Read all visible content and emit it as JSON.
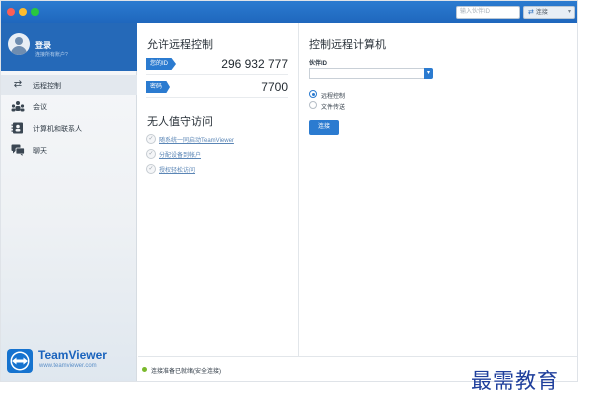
{
  "titlebar": {
    "search_placeholder": "输入伙伴ID",
    "connect_label": "连接"
  },
  "sidebar": {
    "login_title": "登录",
    "login_subtitle": "连接所有账户?",
    "items": [
      {
        "label": "远程控制",
        "icon": "arrows-icon"
      },
      {
        "label": "会议",
        "icon": "meeting-icon"
      },
      {
        "label": "计算机和联系人",
        "icon": "contacts-icon"
      },
      {
        "label": "聊天",
        "icon": "chat-icon"
      }
    ],
    "brand_name": "TeamViewer",
    "brand_url": "www.teamviewer.com"
  },
  "allow": {
    "title": "允许远程控制",
    "id_label": "您的ID",
    "id_value": "296 932 777",
    "password_label": "密码",
    "password_value": "7700"
  },
  "unattended": {
    "title": "无人值守访问",
    "links": [
      "随系统一同启动TeamViewer",
      "分配设备到帐户",
      "授权轻松访问"
    ]
  },
  "control": {
    "title": "控制远程计算机",
    "partner_label": "伙伴ID",
    "partner_value": "",
    "options": [
      "远程控制",
      "文件传送"
    ],
    "selected_option": "远程控制",
    "connect_button": "连接"
  },
  "status": {
    "text": "连接准备已就绪(安全连接)",
    "color": "#7ab92c"
  },
  "watermark": "最需教育",
  "colors": {
    "accent": "#2b7bd0",
    "brand": "#1a63bd"
  }
}
